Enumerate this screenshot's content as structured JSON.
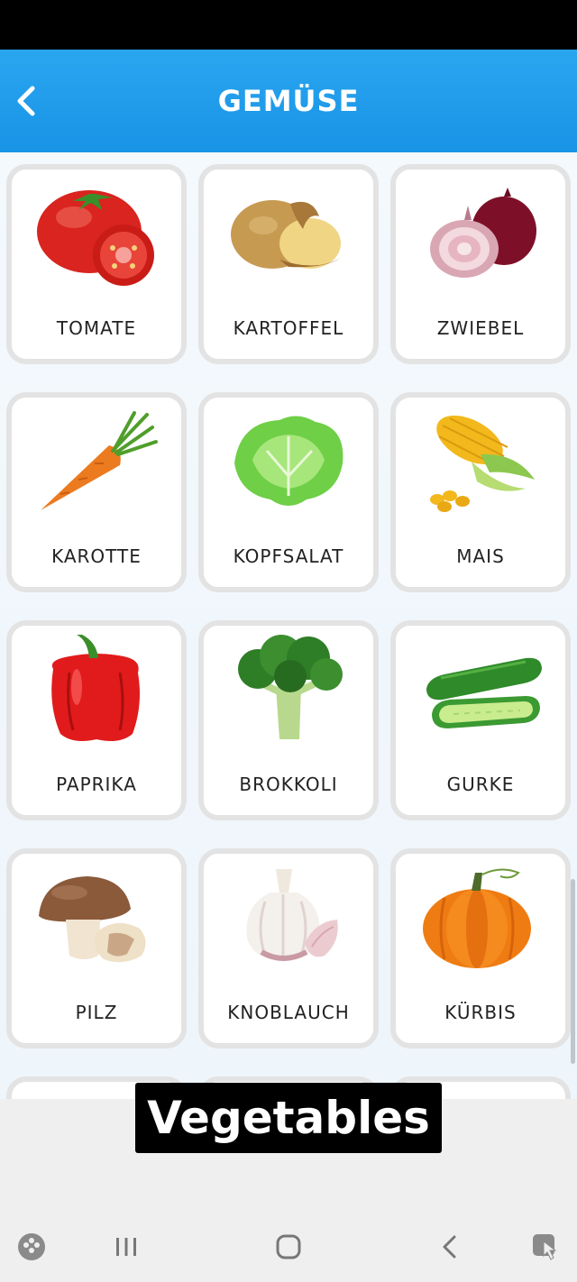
{
  "header": {
    "title": "GEMÜSE",
    "back_icon": "chevron-left-icon"
  },
  "colors": {
    "header": "#1f9be9",
    "card_border": "#e3e3e3",
    "background": "#f3f9fd"
  },
  "items": [
    {
      "label": "TOMATE",
      "icon": "tomato-image"
    },
    {
      "label": "KARTOFFEL",
      "icon": "potato-image"
    },
    {
      "label": "ZWIEBEL",
      "icon": "onion-image"
    },
    {
      "label": "KAROTTE",
      "icon": "carrot-image"
    },
    {
      "label": "KOPFSALAT",
      "icon": "lettuce-image"
    },
    {
      "label": "MAIS",
      "icon": "corn-image"
    },
    {
      "label": "PAPRIKA",
      "icon": "bell-pepper-image"
    },
    {
      "label": "BROKKOLI",
      "icon": "broccoli-image"
    },
    {
      "label": "GURKE",
      "icon": "cucumber-image"
    },
    {
      "label": "PILZ",
      "icon": "mushroom-image"
    },
    {
      "label": "KNOBLAUCH",
      "icon": "garlic-image"
    },
    {
      "label": "KÜRBIS",
      "icon": "pumpkin-image"
    }
  ],
  "caption": "Vegetables",
  "navbar": [
    "game-launcher-icon",
    "recent-apps-icon",
    "home-icon",
    "back-icon",
    "accessibility-icon"
  ]
}
